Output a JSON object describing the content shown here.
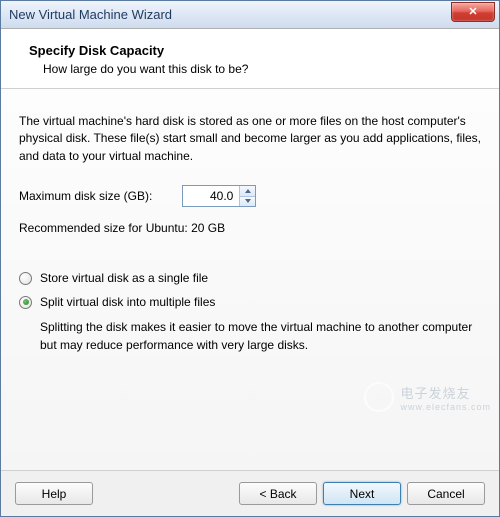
{
  "window": {
    "title": "New Virtual Machine Wizard",
    "close_glyph": "✕"
  },
  "header": {
    "title": "Specify Disk Capacity",
    "subtitle": "How large do you want this disk to be?"
  },
  "content": {
    "description": "The virtual machine's hard disk is stored as one or more files on the host computer's physical disk. These file(s) start small and become larger as you add applications, files, and data to your virtual machine.",
    "size_label": "Maximum disk size (GB):",
    "size_value": "40.0",
    "recommended": "Recommended size for Ubuntu: 20 GB",
    "options": {
      "single": {
        "label": "Store virtual disk as a single file",
        "selected": false
      },
      "split": {
        "label": "Split virtual disk into multiple files",
        "selected": true,
        "description": "Splitting the disk makes it easier to move the virtual machine to another computer but may reduce performance with very large disks."
      }
    }
  },
  "footer": {
    "help": "Help",
    "back": "< Back",
    "next": "Next",
    "cancel": "Cancel"
  },
  "watermark": {
    "text": "电子发烧友",
    "url": "www.elecfans.com"
  }
}
